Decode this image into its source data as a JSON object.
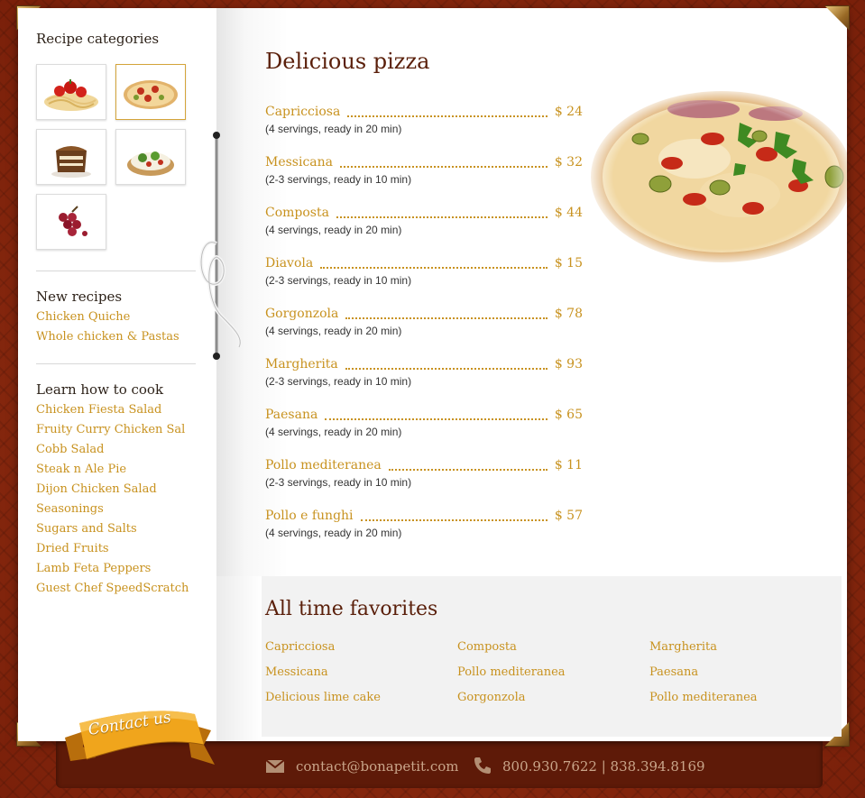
{
  "sidebar": {
    "categories_heading": "Recipe categories",
    "thumbnails": [
      {
        "name": "pasta-thumbnail",
        "icon": "spaghetti-tomato"
      },
      {
        "name": "pizza-thumbnail",
        "icon": "pizza"
      },
      {
        "name": "cake-thumbnail",
        "icon": "chocolate-cake"
      },
      {
        "name": "appetizer-thumbnail",
        "icon": "bruschetta"
      },
      {
        "name": "fruit-thumbnail",
        "icon": "grapes"
      }
    ],
    "new_recipes_heading": "New recipes",
    "new_recipes": [
      "Chicken Quiche",
      "Whole chicken & Pastas"
    ],
    "learn_heading": "Learn how to cook",
    "learn_items": [
      "Chicken Fiesta Salad",
      "Fruity Curry Chicken Sal",
      "Cobb Salad",
      "Steak n Ale Pie",
      "Dijon Chicken Salad",
      "Seasonings",
      "Sugars and Salts",
      "Dried Fruits",
      "Lamb Feta Peppers",
      "Guest Chef SpeedScratch"
    ]
  },
  "main": {
    "title": "Delicious pizza",
    "menu": [
      {
        "name": "Capricciosa",
        "price": "$ 24",
        "desc": "(4 servings, ready in 20 min)"
      },
      {
        "name": "Messicana",
        "price": "$ 32",
        "desc": "(2-3 servings, ready in 10 min)"
      },
      {
        "name": "Composta",
        "price": "$ 44",
        "desc": "(4 servings, ready in 20 min)"
      },
      {
        "name": "Diavola",
        "price": "$ 15",
        "desc": "(2-3 servings, ready in 10 min)"
      },
      {
        "name": "Gorgonzola",
        "price": "$ 78",
        "desc": "(4 servings, ready in 20 min)"
      },
      {
        "name": "Margherita",
        "price": "$ 93",
        "desc": "(2-3 servings, ready in 10 min)"
      },
      {
        "name": "Paesana",
        "price": "$ 65",
        "desc": "(4 servings, ready in 20 min)"
      },
      {
        "name": "Pollo mediteranea",
        "price": "$ 11",
        "desc": "(2-3 servings, ready in 10 min)"
      },
      {
        "name": "Pollo e funghi",
        "price": "$ 57",
        "desc": "(4 servings, ready in 20 min)"
      }
    ]
  },
  "favorites": {
    "title": "All time favorites",
    "columns": [
      [
        "Capricciosa",
        "Messicana",
        "Delicious lime cake"
      ],
      [
        "Composta",
        "Pollo mediteranea",
        "Gorgonzola"
      ],
      [
        "Margherita",
        "Paesana",
        "Pollo mediteranea"
      ]
    ]
  },
  "footer": {
    "contact_button": "Contact us",
    "email": "contact@bonapetit.com",
    "phone": "800.930.7622  |  838.394.8169"
  },
  "colors": {
    "accent_gold": "#c8921f",
    "title_brown": "#5a1f0a",
    "background_red": "#8b2a10"
  }
}
